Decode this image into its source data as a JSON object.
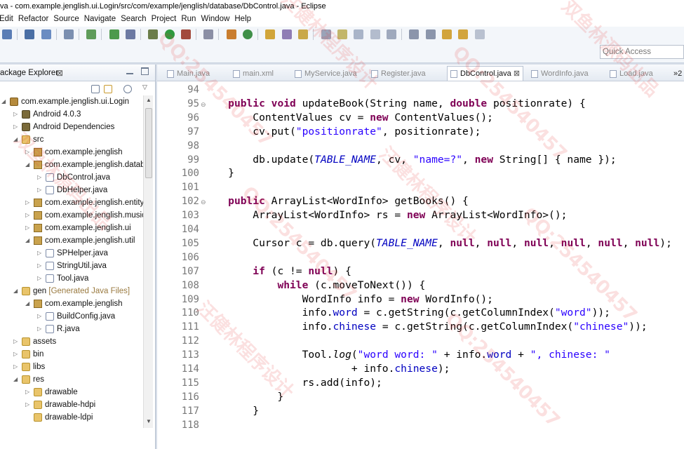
{
  "window": {
    "title": "va - com.example.jenglish.ui.Login/src/com/example/jenglish/database/DbControl.java - Eclipse"
  },
  "menu": [
    "Edit",
    "Refactor",
    "Source",
    "Navigate",
    "Search",
    "Project",
    "Run",
    "Window",
    "Help"
  ],
  "quick_access": {
    "placeholder": "Quick Access"
  },
  "package_explorer": {
    "title": "ackage Explorer",
    "close_glyph": "⊠",
    "tree": [
      {
        "label": "com.example.jenglish.ui.Login",
        "icon": "project-icon",
        "arrow": "◢",
        "indent": 0
      },
      {
        "label": "Android 4.0.3",
        "icon": "library-icon",
        "arrow": "▷",
        "indent": 1
      },
      {
        "label": "Android Dependencies",
        "icon": "library-icon",
        "arrow": "▷",
        "indent": 1
      },
      {
        "label": "src",
        "icon": "folder-icon",
        "arrow": "◢",
        "indent": 1
      },
      {
        "label": "com.example.jenglish",
        "icon": "package-icon",
        "arrow": "▷",
        "indent": 2
      },
      {
        "label": "com.example.jenglish.databa",
        "icon": "package-icon",
        "arrow": "◢",
        "indent": 2
      },
      {
        "label": "DbControl.java",
        "icon": "java-file-icon",
        "arrow": "▷",
        "indent": 3
      },
      {
        "label": "DbHelper.java",
        "icon": "java-file-icon",
        "arrow": "▷",
        "indent": 3
      },
      {
        "label": "com.example.jenglish.entity",
        "icon": "package-icon",
        "arrow": "▷",
        "indent": 2
      },
      {
        "label": "com.example.jenglish.music",
        "icon": "package-icon",
        "arrow": "▷",
        "indent": 2
      },
      {
        "label": "com.example.jenglish.ui",
        "icon": "package-icon",
        "arrow": "▷",
        "indent": 2
      },
      {
        "label": "com.example.jenglish.util",
        "icon": "package-icon",
        "arrow": "◢",
        "indent": 2
      },
      {
        "label": "SPHelper.java",
        "icon": "java-file-icon",
        "arrow": "▷",
        "indent": 3
      },
      {
        "label": "StringUtil.java",
        "icon": "java-file-icon",
        "arrow": "▷",
        "indent": 3
      },
      {
        "label": "Tool.java",
        "icon": "java-file-icon",
        "arrow": "▷",
        "indent": 3
      },
      {
        "label": "gen",
        "suffix": "[Generated Java Files]",
        "icon": "folder-icon",
        "arrow": "◢",
        "indent": 1
      },
      {
        "label": "com.example.jenglish",
        "icon": "package-icon",
        "arrow": "◢",
        "indent": 2
      },
      {
        "label": "BuildConfig.java",
        "icon": "java-file-icon",
        "arrow": "▷",
        "indent": 3
      },
      {
        "label": "R.java",
        "icon": "java-file-icon",
        "arrow": "▷",
        "indent": 3
      },
      {
        "label": "assets",
        "icon": "folder-icon",
        "arrow": "▷",
        "indent": 1
      },
      {
        "label": "bin",
        "icon": "folder-icon",
        "arrow": "▷",
        "indent": 1
      },
      {
        "label": "libs",
        "icon": "folder-icon",
        "arrow": "▷",
        "indent": 1
      },
      {
        "label": "res",
        "icon": "folder-icon",
        "arrow": "◢",
        "indent": 1
      },
      {
        "label": "drawable",
        "icon": "folder-icon",
        "arrow": "▷",
        "indent": 2
      },
      {
        "label": "drawable-hdpi",
        "icon": "folder-icon",
        "arrow": "▷",
        "indent": 2
      },
      {
        "label": "drawable-ldpi",
        "icon": "folder-icon",
        "arrow": "",
        "indent": 2
      }
    ]
  },
  "editor": {
    "tabs": [
      {
        "label": "Main.java",
        "active": false
      },
      {
        "label": "main.xml",
        "active": false
      },
      {
        "label": "MyService.java",
        "active": false
      },
      {
        "label": "Register.java",
        "active": false
      },
      {
        "label": "DbControl.java",
        "active": true
      },
      {
        "label": "WordInfo.java",
        "active": false
      },
      {
        "label": "Load.java",
        "active": false
      }
    ],
    "overflow_label": "»2",
    "lines": [
      {
        "n": "94",
        "html": ""
      },
      {
        "n": "95",
        "fold": true,
        "html": "<span class=\"kw\">public</span> <span class=\"kw\">void</span> updateBook(String name, <span class=\"kw\">double</span> positionrate) {"
      },
      {
        "n": "96",
        "html": "    ContentValues cv = <span class=\"kw\">new</span> ContentValues();"
      },
      {
        "n": "97",
        "html": "    cv.put(<span class=\"str\">\"positionrate\"</span>, positionrate);"
      },
      {
        "n": "98",
        "html": ""
      },
      {
        "n": "99",
        "html": "    db.update(<span class=\"con\">TABLE_NAME</span>, cv, <span class=\"str\">\"name=?\"</span>, <span class=\"kw\">new</span> String[] { name });"
      },
      {
        "n": "100",
        "html": "}"
      },
      {
        "n": "101",
        "html": ""
      },
      {
        "n": "102",
        "fold": true,
        "html": "<span class=\"kw\">public</span> ArrayList&lt;WordInfo&gt; getBooks() {"
      },
      {
        "n": "103",
        "html": "    ArrayList&lt;WordInfo&gt; rs = <span class=\"kw\">new</span> ArrayList&lt;WordInfo&gt;();"
      },
      {
        "n": "104",
        "html": ""
      },
      {
        "n": "105",
        "html": "    Cursor c = db.query(<span class=\"con\">TABLE_NAME</span>, <span class=\"kw\">null</span>, <span class=\"kw\">null</span>, <span class=\"kw\">null</span>, <span class=\"kw\">null</span>, <span class=\"kw\">null</span>, <span class=\"kw\">null</span>);"
      },
      {
        "n": "106",
        "html": ""
      },
      {
        "n": "107",
        "html": "    <span class=\"kw\">if</span> (c != <span class=\"kw\">null</span>) {"
      },
      {
        "n": "108",
        "html": "        <span class=\"kw\">while</span> (c.moveToNext()) {"
      },
      {
        "n": "109",
        "html": "            WordInfo info = <span class=\"kw\">new</span> WordInfo();"
      },
      {
        "n": "110",
        "html": "            info.<span class=\"fld\">word</span> = c.getString(c.getColumnIndex(<span class=\"str\">\"word\"</span>));"
      },
      {
        "n": "111",
        "html": "            info.<span class=\"fld\">chinese</span> = c.getString(c.getColumnIndex(<span class=\"str\">\"chinese\"</span>));"
      },
      {
        "n": "112",
        "html": ""
      },
      {
        "n": "113",
        "html": "            Tool.<span class=\"ita\">log</span>(<span class=\"str\">\"word word: \"</span> + info.<span class=\"fld\">word</span> + <span class=\"str\">\", chinese: \"</span>"
      },
      {
        "n": "114",
        "html": "                    + info.<span class=\"fld\">chinese</span>);"
      },
      {
        "n": "115",
        "html": "            rs.add(info);"
      },
      {
        "n": "116",
        "html": "        }"
      },
      {
        "n": "117",
        "html": "    }"
      },
      {
        "n": "118",
        "html": ""
      }
    ]
  },
  "watermark": {
    "text_a": "QQ:254540457",
    "text_b": "汪健林程序设计",
    "text_c": "双鱼林源码出品"
  },
  "colors": {
    "keyword": "#7f0055",
    "string": "#2a00ff",
    "field": "#0000c0",
    "line_number": "#787878"
  }
}
